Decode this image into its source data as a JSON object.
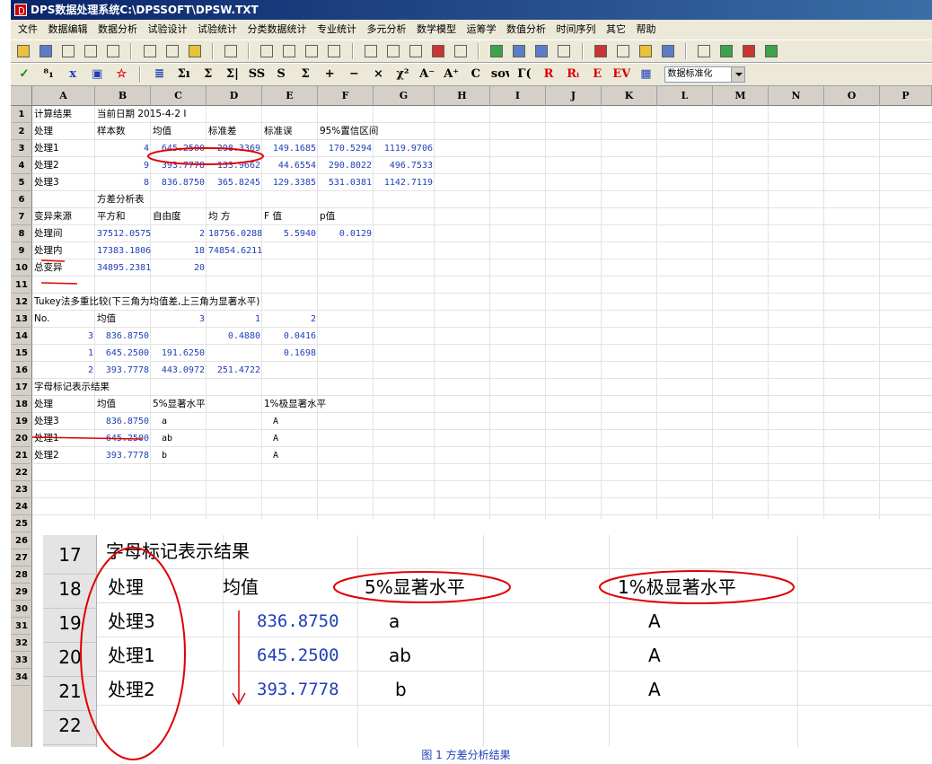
{
  "window": {
    "title": "DPS数据处理系统C:\\DPSSOFT\\DPSW.TXT"
  },
  "menu": [
    "文件",
    "数据编辑",
    "数据分析",
    "试验设计",
    "试验统计",
    "分类数据统计",
    "专业统计",
    "多元分析",
    "数学模型",
    "运筹学",
    "数值分析",
    "时间序列",
    "其它",
    "帮助"
  ],
  "toolbar2": {
    "glyphs": [
      "✓",
      "⁸₁",
      "x",
      "▣",
      "☆",
      "≣",
      "Σı",
      "Σ",
      "Σ|",
      "SS",
      "S",
      "Σ",
      "+",
      "−",
      "×",
      "χ²",
      "A⁻",
      "A⁺",
      "C",
      "sov",
      "Γ(",
      "R",
      "Rᵢ",
      "E",
      "EV",
      "▦"
    ],
    "format_select": "数据标准化"
  },
  "columns": [
    "A",
    "B",
    "C",
    "D",
    "E",
    "F",
    "G",
    "H",
    "I",
    "J",
    "K",
    "L",
    "M",
    "N",
    "O",
    "P"
  ],
  "rows": [
    "1",
    "2",
    "3",
    "4",
    "5",
    "6",
    "7",
    "8",
    "9",
    "10",
    "11",
    "12",
    "13",
    "14",
    "15",
    "16",
    "17",
    "18",
    "19",
    "20",
    "21",
    "22",
    "23",
    "24",
    "25",
    "26",
    "27",
    "28",
    "29",
    "30",
    "31",
    "32",
    "33",
    "34"
  ],
  "sheet": {
    "r1": {
      "a": "计算结果",
      "b": "当前日期 2015-4-2 I"
    },
    "r2": [
      "处理",
      "样本数",
      "均值",
      "标准差",
      "标准误",
      "95%置信区间"
    ],
    "r3": [
      "处理1",
      "4",
      "645.2500",
      "298.3369",
      "149.1685",
      "170.5294",
      "1119.9706"
    ],
    "r4": [
      "处理2",
      "9",
      "393.7778",
      "133.9662",
      "44.6554",
      "290.8022",
      "496.7533"
    ],
    "r5": [
      "处理3",
      "8",
      "836.8750",
      "365.8245",
      "129.3385",
      "531.0381",
      "1142.7119"
    ],
    "r6": "方差分析表",
    "r7": [
      "变异来源",
      "平方和",
      "自由度",
      "均 方",
      "F 值",
      "p值"
    ],
    "r8": [
      "处理间",
      "37512.0575",
      "2",
      "18756.0288",
      "5.5940",
      "0.0129"
    ],
    "r9": [
      "处理内",
      "17383.1806",
      "18",
      "74854.6211"
    ],
    "r10": [
      "总变异",
      "34895.2381",
      "20"
    ],
    "r12": "Tukey法多重比较(下三角为均值差,上三角为显著水平)",
    "r13": [
      "No.",
      "均值",
      "3",
      "1",
      "2"
    ],
    "r14": [
      "3",
      "836.8750",
      "0.4880",
      "0.0416"
    ],
    "r15": [
      "1",
      "645.2500",
      "191.6250",
      "0.1698"
    ],
    "r16": [
      "2",
      "393.7778",
      "443.0972",
      "251.4722"
    ],
    "r17": "字母标记表示结果",
    "r18": [
      "处理",
      "均值",
      "5%显著水平",
      "1%极显著水平"
    ],
    "r19": [
      "处理3",
      "836.8750",
      "a",
      "A"
    ],
    "r20": [
      "处理1",
      "645.2500",
      "ab",
      "A"
    ],
    "r21": [
      "处理2",
      "393.7778",
      "b",
      "A"
    ]
  },
  "zoom": {
    "rows": [
      "17",
      "18",
      "19",
      "20",
      "21",
      "22"
    ],
    "title": "字母标记表示结果",
    "header": [
      "处理",
      "均值",
      "5%显著水平",
      "1%极显著水平"
    ],
    "r19": [
      "处理3",
      "836.8750",
      "a",
      "A"
    ],
    "r20": [
      "处理1",
      "645.2500",
      "ab",
      "A"
    ],
    "r21": [
      "处理2",
      "393.7778",
      "b",
      "A"
    ]
  },
  "caption": "图 1 方差分析结果",
  "colors": {
    "title_start": "#0a246a",
    "title_end": "#3a6ea5",
    "number_blue": "#1f3fb8",
    "annotation_red": "#e00000"
  }
}
